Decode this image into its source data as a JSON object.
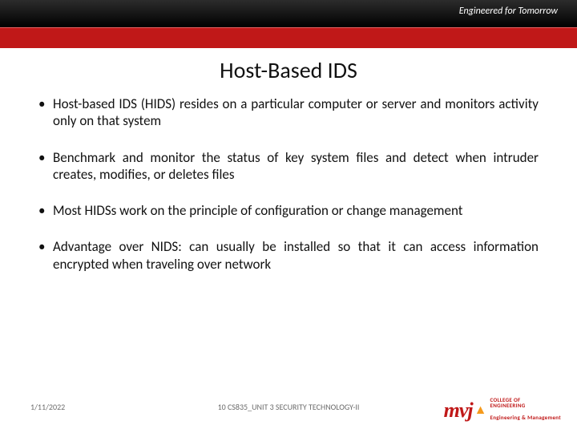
{
  "header": {
    "tagline": "Engineered for Tomorrow",
    "title": "Host-Based IDS"
  },
  "bullets": [
    "Host-based IDS (HIDS) resides on a particular computer or server and monitors activity only on that system",
    "Benchmark and monitor the status of key system files and detect when intruder creates, modifies, or deletes files",
    "Most HIDSs work on the principle of configuration or change management",
    "Advantage over NIDS: can usually be installed so that it can access information encrypted when traveling over network"
  ],
  "footer": {
    "date": "1/11/2022",
    "code": "10 CS835_UNIT 3 SECURITY TECHNOLOGY-II"
  },
  "logo": {
    "mark": "mvj",
    "line1": "COLLEGE OF",
    "line2": "ENGINEERING",
    "sub": "Engineering & Management"
  }
}
